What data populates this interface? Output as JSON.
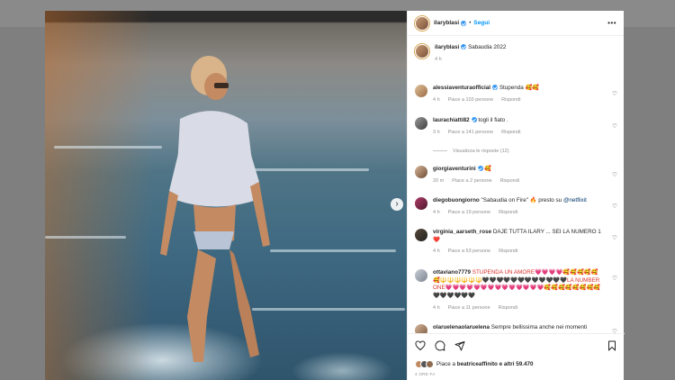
{
  "post": {
    "username": "ilaryblasi",
    "follow_label": "Segui",
    "caption": "Sabaudia 2022",
    "caption_time": "4 h"
  },
  "comments": [
    {
      "user": "alessiaventuraofficial",
      "verified": true,
      "text": "Stupenda 🥰🥰",
      "time": "4 h",
      "likes": "Piace a 103 persone",
      "reply": "Rispondi"
    },
    {
      "user": "laurachiatti82",
      "verified": true,
      "text": "togli il fiato .",
      "time": "3 h",
      "likes": "Piace a 141 persone",
      "reply": "Rispondi",
      "view_replies": "Visualizza le risposte (12)"
    },
    {
      "user": "giorgiaventurini",
      "verified": true,
      "text": "🥰",
      "time": "20 m",
      "likes": "Piace a 2 persone",
      "reply": "Rispondi"
    },
    {
      "user": "diegobuongiorno",
      "verified": false,
      "text": "\"Sabaudia on Fire\" 🔥 presto su ",
      "mention": "@netflixit",
      "time": "4 h",
      "likes": "Piace a 19 persone",
      "reply": "Rispondi"
    },
    {
      "user": "virginia_aarseth_rose",
      "verified": false,
      "text": "DAJE TUTTA ILARY ... SEI LA NUMERO 1 ❤️",
      "time": "4 h",
      "likes": "Piace a 53 persone",
      "reply": "Rispondi"
    },
    {
      "user": "ottaviano7779",
      "verified": false,
      "text": "STUPENDA UN AMORE💗💗💗💗🥰🥰🥰🥰🥰🥰🔱🔱🔱🔱🔱🔱🖤🖤🖤🖤🖤🖤🖤🖤🖤🖤🖤🖤LA NUMBER ONE💗💗💗💗💗💗💗💗💗💗💗💗💗💗🥰🥰🥰🥰🥰🥰🥰🥰🖤🖤🖤🖤🖤🖤",
      "time": "4 h",
      "likes": "Piace a 11 persone",
      "reply": "Rispondi"
    },
    {
      "user": "olaruelenaolaruelena",
      "verified": false,
      "text": "Sempre bellissima anche nei momenti"
    }
  ],
  "footer": {
    "likes_prefix": "Piace a ",
    "likes_user": "beatriceaffinito",
    "likes_suffix": " e altri 59.470",
    "time": "4 ORE FA"
  },
  "icons": [
    "more-icon",
    "heart-icon",
    "comment-icon",
    "share-icon",
    "bookmark-icon",
    "chevron-right-icon"
  ]
}
